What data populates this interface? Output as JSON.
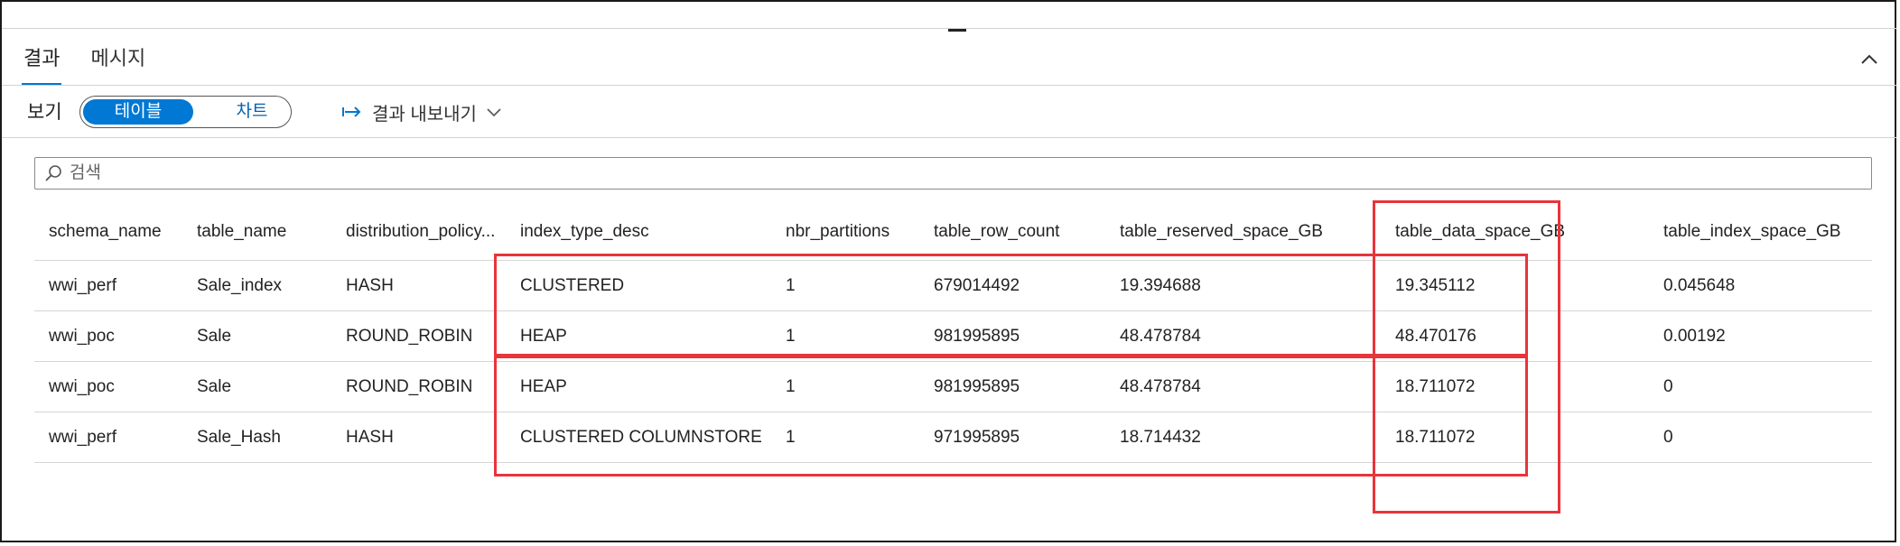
{
  "tabs": [
    {
      "label": "결과",
      "active": true
    },
    {
      "label": "메시지",
      "active": false
    }
  ],
  "toolbar": {
    "view_label": "보기",
    "toggle_table": "테이블",
    "toggle_chart": "차트",
    "export_label": "결과 내보내기"
  },
  "search": {
    "placeholder": "검색",
    "value": ""
  },
  "table": {
    "columns": [
      "schema_name",
      "table_name",
      "distribution_policy...",
      "index_type_desc",
      "nbr_partitions",
      "table_row_count",
      "table_reserved_space_GB",
      "table_data_space_GB",
      "table_index_space_GB"
    ],
    "rows": [
      [
        "wwi_perf",
        "Sale_index",
        "HASH",
        "CLUSTERED",
        "1",
        "679014492",
        "19.394688",
        "19.345112",
        "0.045648"
      ],
      [
        "wwi_poc",
        "Sale",
        "ROUND_ROBIN",
        "HEAP",
        "1",
        "981995895",
        "48.478784",
        "48.470176",
        "0.00192"
      ],
      [
        "wwi_poc",
        "Sale",
        "ROUND_ROBIN",
        "HEAP",
        "1",
        "981995895",
        "48.478784",
        "18.711072",
        "0"
      ],
      [
        "wwi_perf",
        "Sale_Hash",
        "HASH",
        "CLUSTERED COLUMNSTORE",
        "1",
        "971995895",
        "18.714432",
        "18.711072",
        "0"
      ]
    ]
  },
  "colors": {
    "accent": "#0078d4",
    "highlight": "#e8343b"
  },
  "icons": {
    "collapse": "chevron-up-icon",
    "export": "arrow-right-bar-icon",
    "dropdown": "chevron-down-icon",
    "search": "search-icon"
  }
}
